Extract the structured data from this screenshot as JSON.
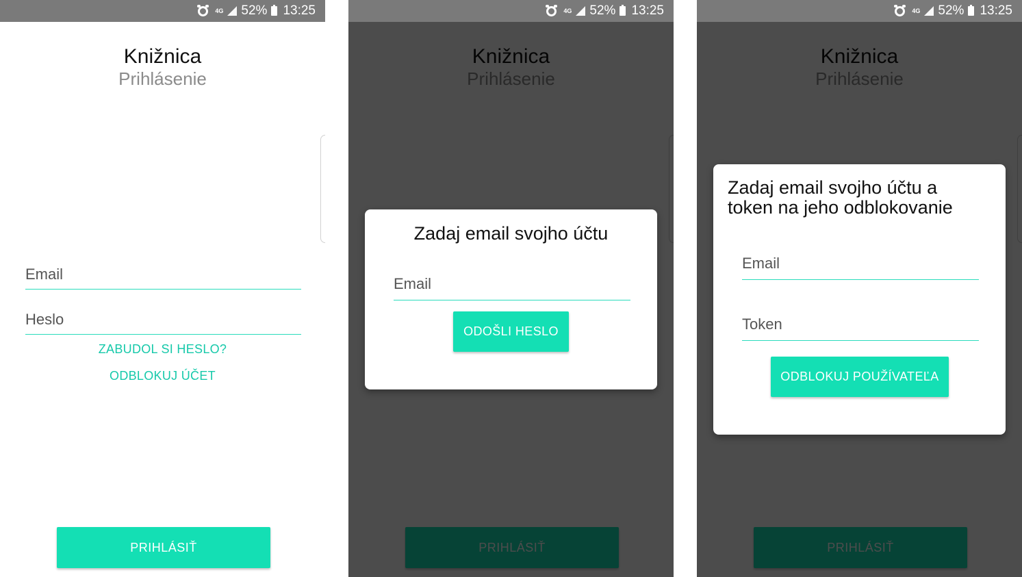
{
  "status_bar": {
    "network": "4G",
    "battery": "52%",
    "time": "13:25"
  },
  "app": {
    "title": "Knižnica",
    "subtitle": "Prihlásenie"
  },
  "login": {
    "email_placeholder": "Email",
    "password_placeholder": "Heslo",
    "forgot_password_link": "ZABUDOL SI HESLO?",
    "unlock_account_link": "ODBLOKUJ ÚČET",
    "login_button": "PRIHLÁSIŤ"
  },
  "forgot_dialog": {
    "title": "Zadaj email svojho účtu",
    "email_placeholder": "Email",
    "submit_button": "ODOŠLI HESLO"
  },
  "unlock_dialog": {
    "title_line1": "Zadaj email svojho účtu a",
    "title_line2": "token na jeho odblokovanie",
    "email_placeholder": "Email",
    "token_placeholder": "Token",
    "submit_button": "ODBLOKUJ POUŽÍVATEĽA"
  },
  "colors": {
    "accent": "#14dfb4",
    "link": "#16c9aa",
    "status_bar": "#7a7a7a",
    "scrim": "#4b4b4b"
  }
}
